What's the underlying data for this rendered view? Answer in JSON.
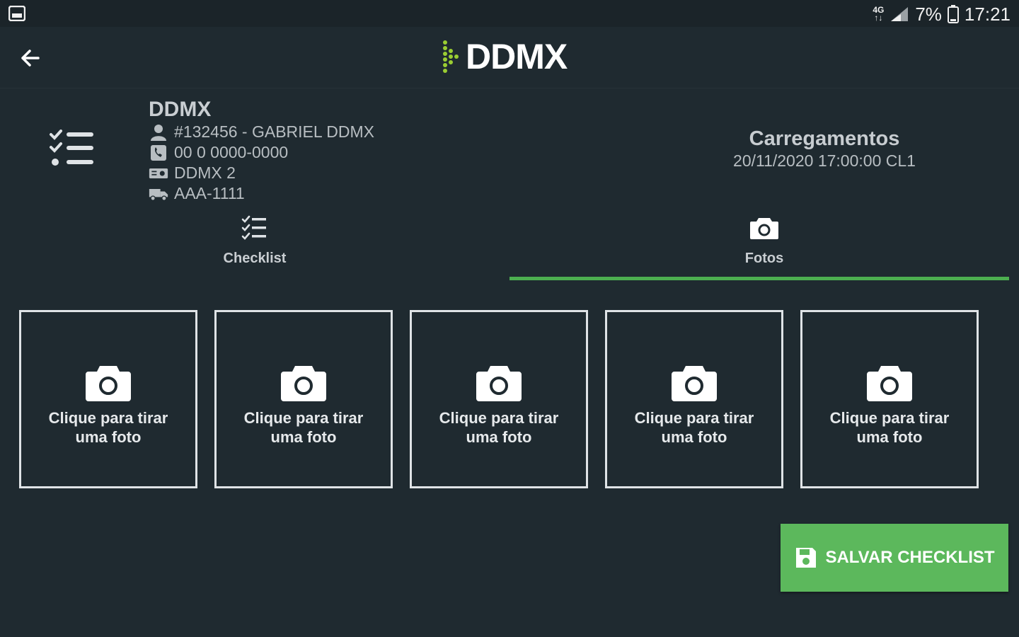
{
  "status_bar": {
    "network": "4G",
    "battery": "7%",
    "time": "17:21"
  },
  "app_bar": {
    "logo_text": "DDMX",
    "icons": [
      "back-arrow-icon",
      "ddmx-logo"
    ]
  },
  "driver": {
    "name": "DDMX",
    "id_line": "#132456 - GABRIEL DDMX",
    "phone": "00 0 0000-0000",
    "unit": "DDMX 2",
    "plate": "AAA-1111"
  },
  "load": {
    "title": "Carregamentos",
    "subtitle": "20/11/2020 17:00:00 CL1"
  },
  "tabs": [
    {
      "label": "Checklist",
      "icon": "checklist-icon",
      "active": false
    },
    {
      "label": "Fotos",
      "icon": "camera-icon",
      "active": true
    }
  ],
  "photo_slots": [
    {
      "caption": "Clique para tirar uma foto"
    },
    {
      "caption": "Clique para tirar uma foto"
    },
    {
      "caption": "Clique para tirar uma foto"
    },
    {
      "caption": "Clique para tirar uma foto"
    },
    {
      "caption": "Clique para tirar uma foto"
    }
  ],
  "save_button": {
    "label": "SALVAR CHECKLIST",
    "icon": "save-icon"
  },
  "colors": {
    "background": "#1f2a30",
    "accent": "#4caf50",
    "button": "#5cb85c",
    "logo_green": "#9acd32"
  }
}
